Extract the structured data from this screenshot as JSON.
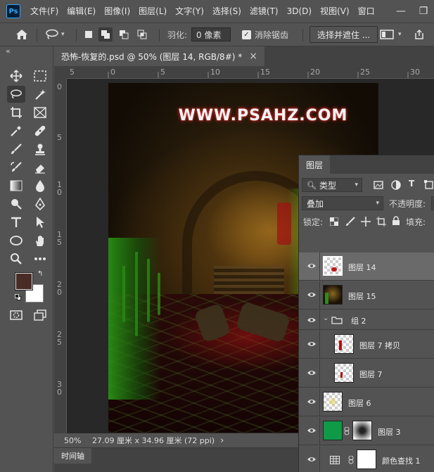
{
  "app": {
    "logo": "Ps"
  },
  "menu": [
    "文件(F)",
    "编辑(E)",
    "图像(I)",
    "图层(L)",
    "文字(Y)",
    "选择(S)",
    "滤镜(T)",
    "3D(D)",
    "视图(V)",
    "窗口"
  ],
  "window_controls": {
    "minimize": "—",
    "restore": "❐"
  },
  "options": {
    "feather_label": "羽化:",
    "feather_value": "0 像素",
    "antialias_label": "消除锯齿",
    "antialias_checked": true,
    "select_mask_label": "选择并遮住 ..."
  },
  "toolbar": {
    "collapse": "«",
    "foreground_color": "#4a2c27",
    "background_color": "#ffffff"
  },
  "document": {
    "tab_title": "恐怖-恢复的.psd @ 50% (图层 14, RGB/8#) *",
    "close_glyph": "×",
    "ruler_top_ticks": [
      "0",
      "5",
      "10",
      "15",
      "20",
      "25",
      "30"
    ],
    "ruler_left_ticks": [
      "0",
      "5",
      "1\n0",
      "1\n5",
      "2\n0",
      "2\n5",
      "3\n0"
    ],
    "watermark": "WWW.PSAHZ.COM"
  },
  "status": {
    "zoom": "50%",
    "dimensions": "27.09 厘米 x 34.96 厘米 (72 ppi)",
    "arrow": "›"
  },
  "timeline": {
    "label": "时间轴"
  },
  "layers_panel": {
    "tab": "图层",
    "filter_kind": "类型",
    "blend_mode": "叠加",
    "opacity_label": "不透明度:",
    "lock_label": "锁定:",
    "fill_label": "填充:",
    "layers": [
      {
        "name": "图层 14",
        "selected": true
      },
      {
        "name": "图层 15",
        "selected": false
      },
      {
        "name": "组 2",
        "selected": false
      },
      {
        "name": "图层 7 拷贝",
        "selected": false
      },
      {
        "name": "图层 7",
        "selected": false
      },
      {
        "name": "图层 6",
        "selected": false
      },
      {
        "name": "图层 3",
        "selected": false
      },
      {
        "name": "颜色查找 1",
        "selected": false
      }
    ]
  }
}
